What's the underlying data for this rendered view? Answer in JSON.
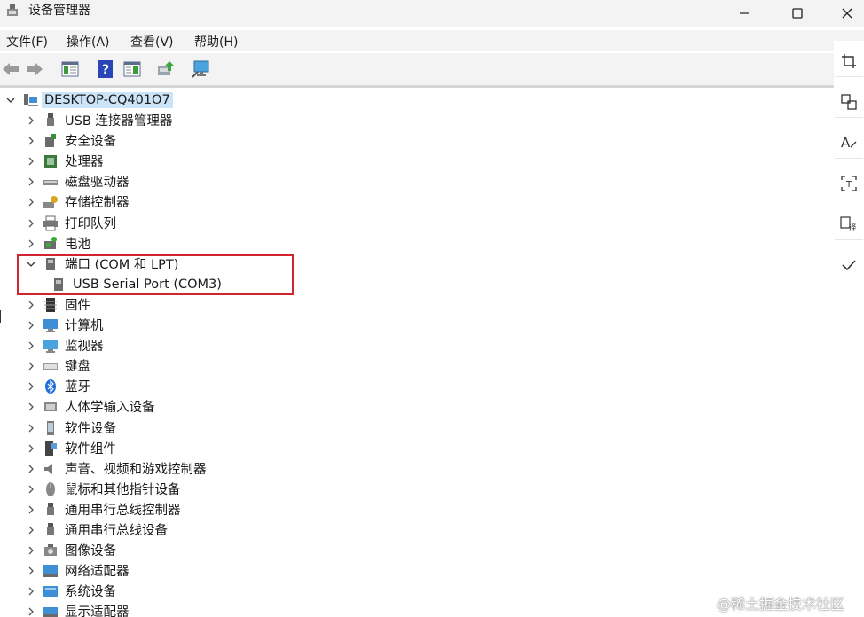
{
  "window": {
    "title": "设备管理器"
  },
  "menu": {
    "items": [
      "文件(F)",
      "操作(A)",
      "查看(V)",
      "帮助(H)"
    ]
  },
  "tree": {
    "root": "DESKTOP-CQ401O7",
    "nodes": [
      {
        "label": "USB 连接器管理器",
        "icon": "usb-connector-icon",
        "expanded": false
      },
      {
        "label": "安全设备",
        "icon": "security-device-icon",
        "expanded": false
      },
      {
        "label": "处理器",
        "icon": "processor-icon",
        "expanded": false
      },
      {
        "label": "磁盘驱动器",
        "icon": "disk-drive-icon",
        "expanded": false
      },
      {
        "label": "存储控制器",
        "icon": "storage-controller-icon",
        "expanded": false
      },
      {
        "label": "打印队列",
        "icon": "printer-icon",
        "expanded": false
      },
      {
        "label": "电池",
        "icon": "battery-icon",
        "expanded": false
      },
      {
        "label": "端口 (COM 和 LPT)",
        "icon": "port-icon",
        "expanded": true
      },
      {
        "label": "USB Serial Port (COM3)",
        "icon": "serial-port-icon",
        "child": true
      },
      {
        "label": "固件",
        "icon": "firmware-icon",
        "expanded": false
      },
      {
        "label": "计算机",
        "icon": "computer-icon",
        "expanded": false
      },
      {
        "label": "监视器",
        "icon": "monitor-icon",
        "expanded": false
      },
      {
        "label": "键盘",
        "icon": "keyboard-icon",
        "expanded": false
      },
      {
        "label": "蓝牙",
        "icon": "bluetooth-icon",
        "expanded": false
      },
      {
        "label": "人体学输入设备",
        "icon": "hid-icon",
        "expanded": false
      },
      {
        "label": "软件设备",
        "icon": "software-device-icon",
        "expanded": false
      },
      {
        "label": "软件组件",
        "icon": "software-component-icon",
        "expanded": false
      },
      {
        "label": "声音、视频和游戏控制器",
        "icon": "speaker-icon",
        "expanded": false
      },
      {
        "label": "鼠标和其他指针设备",
        "icon": "mouse-icon",
        "expanded": false
      },
      {
        "label": "通用串行总线控制器",
        "icon": "usb-controller-icon",
        "expanded": false
      },
      {
        "label": "通用串行总线设备",
        "icon": "usb-device-icon",
        "expanded": false
      },
      {
        "label": "图像设备",
        "icon": "camera-icon",
        "expanded": false
      },
      {
        "label": "网络适配器",
        "icon": "network-adapter-icon",
        "expanded": false
      },
      {
        "label": "系统设备",
        "icon": "system-device-icon",
        "expanded": false
      },
      {
        "label": "显示适配器",
        "icon": "display-adapter-icon",
        "expanded": false
      }
    ]
  },
  "watermark": "@稀土掘金技术社区",
  "colors": {
    "selection": "#cce4f7",
    "highlight_border": "#d1242f",
    "bar_bg": "#f3f3f3"
  }
}
